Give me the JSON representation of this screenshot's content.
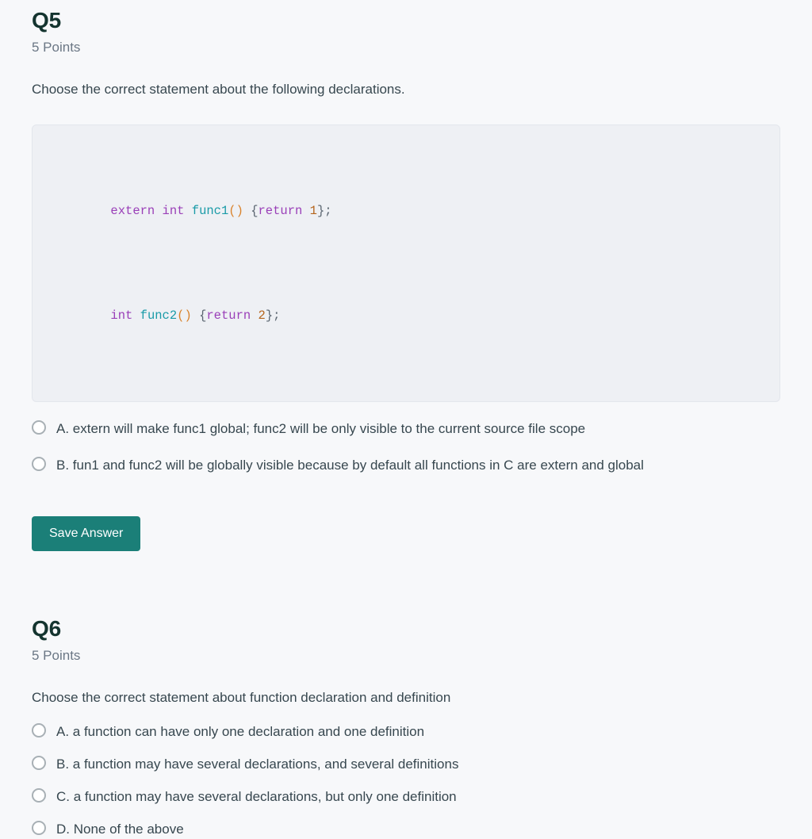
{
  "theme": {
    "page_background": "#f7f8fa",
    "text_color": "#37474f",
    "heading_color": "#14342f",
    "muted_color": "#6b7785",
    "accent_button": "#1b7f78",
    "code_background": "#eef0f4",
    "radio_border": "#a8b0b5"
  },
  "questions": [
    {
      "id": "q5",
      "title": "Q5",
      "points": "5 Points",
      "prompt": "Choose the correct statement about the following declarations.",
      "code": {
        "language": "c",
        "lines": [
          {
            "tokens": [
              {
                "text": "extern",
                "type": "keyword"
              },
              {
                "text": " ",
                "type": "plain"
              },
              {
                "text": "int",
                "type": "keyword"
              },
              {
                "text": " ",
                "type": "plain"
              },
              {
                "text": "func1",
                "type": "function"
              },
              {
                "text": "()",
                "type": "paren"
              },
              {
                "text": " {",
                "type": "punct"
              },
              {
                "text": "return",
                "type": "keyword"
              },
              {
                "text": " ",
                "type": "plain"
              },
              {
                "text": "1",
                "type": "number"
              },
              {
                "text": "};",
                "type": "punct"
              }
            ],
            "plain": "extern int func1() {return 1};"
          },
          {
            "tokens": [
              {
                "text": "int",
                "type": "keyword"
              },
              {
                "text": " ",
                "type": "plain"
              },
              {
                "text": "func2",
                "type": "function"
              },
              {
                "text": "()",
                "type": "paren"
              },
              {
                "text": " {",
                "type": "punct"
              },
              {
                "text": "return",
                "type": "keyword"
              },
              {
                "text": " ",
                "type": "plain"
              },
              {
                "text": "2",
                "type": "number"
              },
              {
                "text": "};",
                "type": "punct"
              }
            ],
            "plain": "int func2() {return 2};"
          }
        ]
      },
      "options": [
        {
          "key": "A",
          "label": "A. extern will make func1 global; func2 will be only visible to the current source file scope",
          "selected": false
        },
        {
          "key": "B",
          "label": "B. fun1 and func2 will be globally visible because by default all functions in C are extern and global",
          "selected": false
        }
      ],
      "save_button_label": "Save Answer"
    },
    {
      "id": "q6",
      "title": "Q6",
      "points": "5 Points",
      "prompt": "Choose the correct statement about function declaration and definition",
      "options": [
        {
          "key": "A",
          "label": "A. a function can have only one declaration and one definition",
          "selected": false
        },
        {
          "key": "B",
          "label": "B. a function may have several declarations, and several definitions",
          "selected": false
        },
        {
          "key": "C",
          "label": "C. a function may have several declarations, but only one definition",
          "selected": false
        },
        {
          "key": "D",
          "label": "D. None of the above",
          "selected": false
        }
      ]
    }
  ]
}
